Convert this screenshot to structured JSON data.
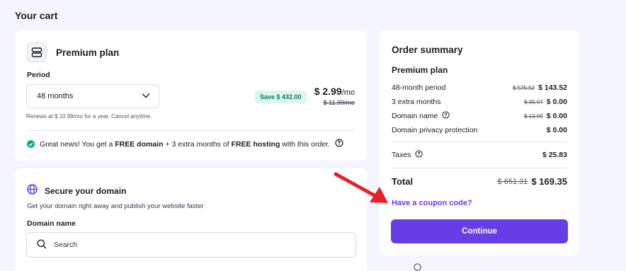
{
  "page": {
    "title": "Your cart"
  },
  "plan": {
    "name": "Premium plan",
    "icon": "server-icon",
    "period_label": "Period",
    "period_value": "48 months",
    "save_badge": "Save $ 432.00",
    "price": "$ 2.99",
    "price_unit": "/mo",
    "old_price": "$ 11.99/mo",
    "renew_note": "Renews at $ 10.99/mo for a year. Cancel anytime.",
    "promo": {
      "p1": "Great news! You get a ",
      "b1": "FREE domain",
      "p2": " + 3 extra months of ",
      "b2": "FREE hosting",
      "p3": " with this order."
    }
  },
  "domain": {
    "title": "Secure your domain",
    "subtitle": "Get your domain right away and publish your website faster",
    "field_label": "Domain name",
    "search_placeholder": "Search"
  },
  "summary": {
    "title": "Order summary",
    "plan": "Premium plan",
    "rows": [
      {
        "label": "48-month period",
        "old": "$ 575.52",
        "value": "$ 143.52"
      },
      {
        "label": "3 extra months",
        "old": "$ 35.97",
        "value": "$ 0.00"
      },
      {
        "label": "Domain name",
        "old": "$ 13.99",
        "value": "$ 0.00"
      },
      {
        "label": "Domain privacy protection",
        "old": "",
        "value": "$ 0.00"
      }
    ],
    "taxes_label": "Taxes",
    "taxes_value": "$ 25.83",
    "total_label": "Total",
    "total_old": "$ 651.31",
    "total_value": "$ 169.35",
    "coupon": "Have a coupon code?",
    "continue": "Continue"
  },
  "colors": {
    "accent": "#673de6",
    "success": "#00b090",
    "arrow": "#e8202a"
  }
}
